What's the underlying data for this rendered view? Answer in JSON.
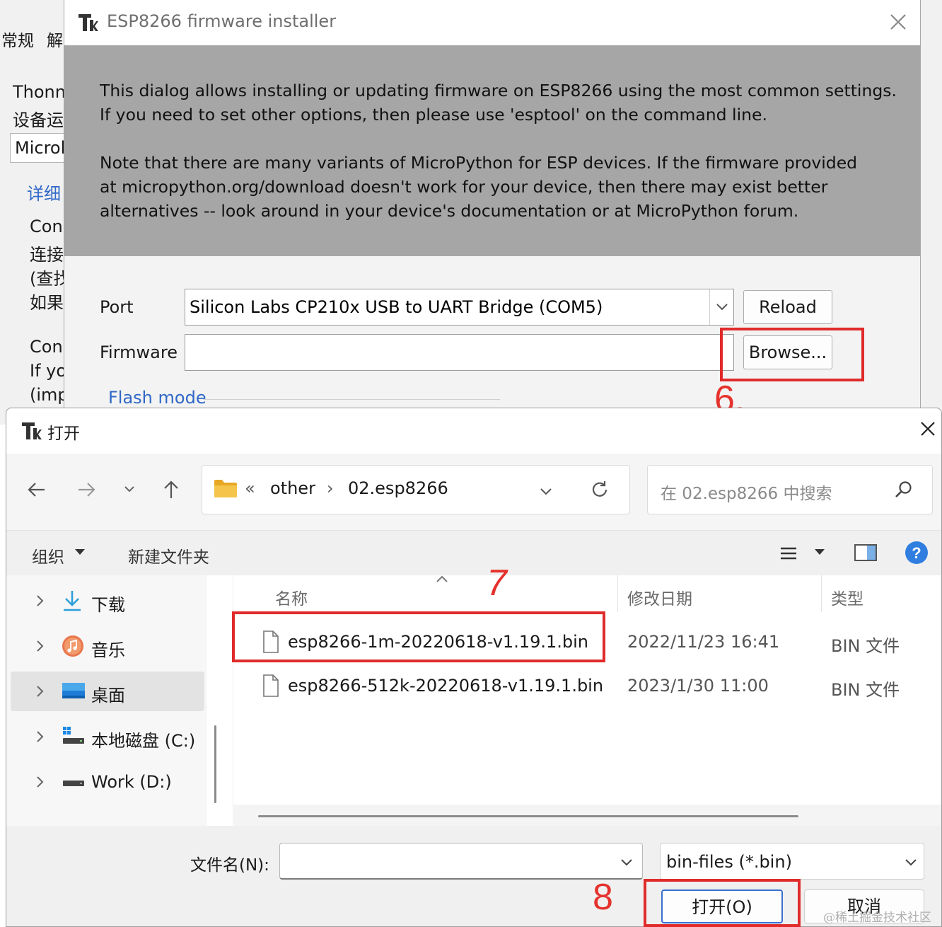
{
  "background_window": {
    "tabs": [
      "常规",
      "解"
    ],
    "lines": [
      "Thonn",
      "设备运"
    ],
    "combo_value": "Microl",
    "section_link": "详细",
    "text_lines_1": [
      "Conı",
      "连接",
      "(查找",
      "如果"
    ],
    "text_lines_2": [
      "Conı",
      "If yo",
      "(imp"
    ]
  },
  "esp_dialog": {
    "title": "ESP8266 firmware installer",
    "info": [
      "This dialog allows installing or updating firmware on ESP8266 using the most common settings.",
      "If you need to set other options, then please use 'esptool' on the command line.",
      "Note that there are many variants of MicroPython for ESP devices. If the firmware provided",
      "at micropython.org/download doesn't work for your device, then there may exist better",
      "alternatives -- look around in your device's documentation or at MicroPython forum."
    ],
    "port_label": "Port",
    "port_value": "Silicon Labs CP210x USB to UART Bridge (COM5)",
    "reload_label": "Reload",
    "firmware_label": "Firmware",
    "firmware_value": "",
    "browse_label": "Browse...",
    "flash_mode_label": "Flash mode"
  },
  "annotations": {
    "step6": "6.",
    "step7": "7",
    "step8": "8",
    "highlight_color": "#e02b2b"
  },
  "open_dialog": {
    "title": "打开",
    "breadcrumb": {
      "overflow": "«",
      "parent": "other",
      "separator": "›",
      "current": "02.esp8266"
    },
    "search_placeholder": "在 02.esp8266 中搜索",
    "toolbar": {
      "organize": "组织",
      "new_folder": "新建文件夹"
    },
    "sidebar": [
      {
        "label": "下载",
        "icon": "download-icon"
      },
      {
        "label": "音乐",
        "icon": "music-icon"
      },
      {
        "label": "桌面",
        "icon": "desktop-icon",
        "selected": true
      },
      {
        "label": "本地磁盘 (C:)",
        "icon": "drive-icon"
      },
      {
        "label": "Work (D:)",
        "icon": "drive-icon"
      }
    ],
    "columns": [
      "名称",
      "修改日期",
      "类型"
    ],
    "files": [
      {
        "name": "esp8266-1m-20220618-v1.19.1.bin",
        "date": "2022/11/23 16:41",
        "type": "BIN 文件"
      },
      {
        "name": "esp8266-512k-20220618-v1.19.1.bin",
        "date": "2023/1/30 11:00",
        "type": "BIN 文件"
      }
    ],
    "filename_label": "文件名(N):",
    "filename_value": "",
    "filter_value": "bin-files (*.bin)",
    "open_button": "打开(O)",
    "cancel_button": "取消"
  },
  "watermark": "@稀土掘金技术社区",
  "colors": {
    "accent_blue": "#2f68c8",
    "info_panel": "#a6a6a6",
    "folder_yellow": "#f4c54a"
  }
}
